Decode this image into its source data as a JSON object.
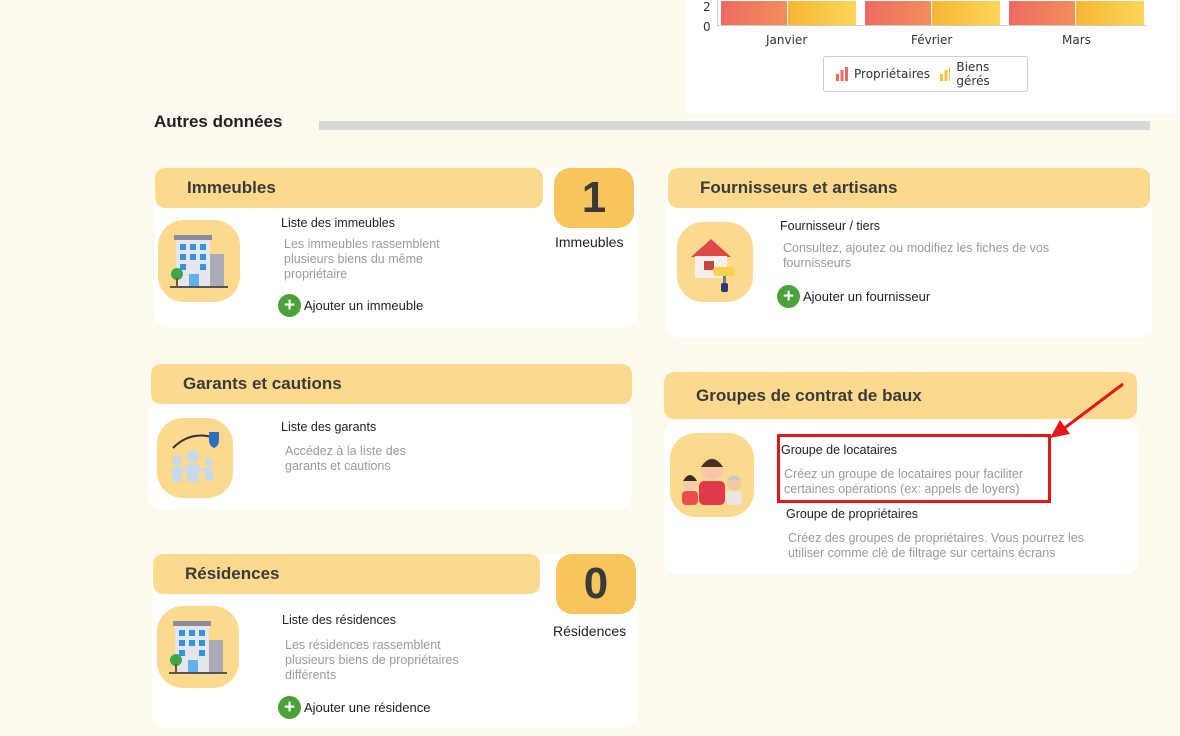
{
  "chart_data": {
    "type": "bar",
    "categories": [
      "Janvier",
      "Février",
      "Mars"
    ],
    "y_ticks": [
      "2",
      "0"
    ],
    "series": [
      {
        "name": "Propriétaires",
        "color": "#ee6b5f"
      },
      {
        "name": "Biens gérés",
        "color": "#f9c23c"
      }
    ],
    "legend_position": "bottom-center"
  },
  "section": {
    "title": "Autres données"
  },
  "immeubles": {
    "header": "Immeubles",
    "item_title": "Liste des immeubles",
    "item_desc": "Les immeubles rassemblent plusieurs biens du même propriétaire",
    "add_label": "Ajouter un immeuble",
    "count": "1",
    "count_label": "Immeubles",
    "icon": "building-icon"
  },
  "fournisseurs": {
    "header": "Fournisseurs et artisans",
    "item_title": "Fournisseur / tiers",
    "item_desc": "Consultez, ajoutez ou modifiez les fiches de vos fournisseurs",
    "add_label": "Ajouter un fournisseur",
    "icon": "house-paint-icon"
  },
  "garants": {
    "header": "Garants et cautions",
    "item_title": "Liste des garants",
    "item_desc": "Accédez à la liste des garants et cautions",
    "icon": "family-shield-icon"
  },
  "groupes": {
    "header": "Groupes de contrat de baux",
    "item1_title": "Groupe de locataires",
    "item1_desc": "Créez un groupe de locataires pour faciliter certaines opérations (ex: appels de loyers)",
    "item2_title": "Groupe de propriétaires",
    "item2_desc": "Créez des groupes de propriétaires. Vous pourrez les utiliser comme clé de filtrage sur certains écrans",
    "icon": "people-group-icon"
  },
  "residences": {
    "header": "Résidences",
    "item_title": "Liste des résidences",
    "item_desc": "Les résidences rassemblent plusieurs biens de propriétaires différents",
    "add_label": "Ajouter une résidence",
    "count": "0",
    "count_label": "Résidences",
    "icon": "building-icon"
  },
  "annotation": {
    "color": "#e01818"
  }
}
